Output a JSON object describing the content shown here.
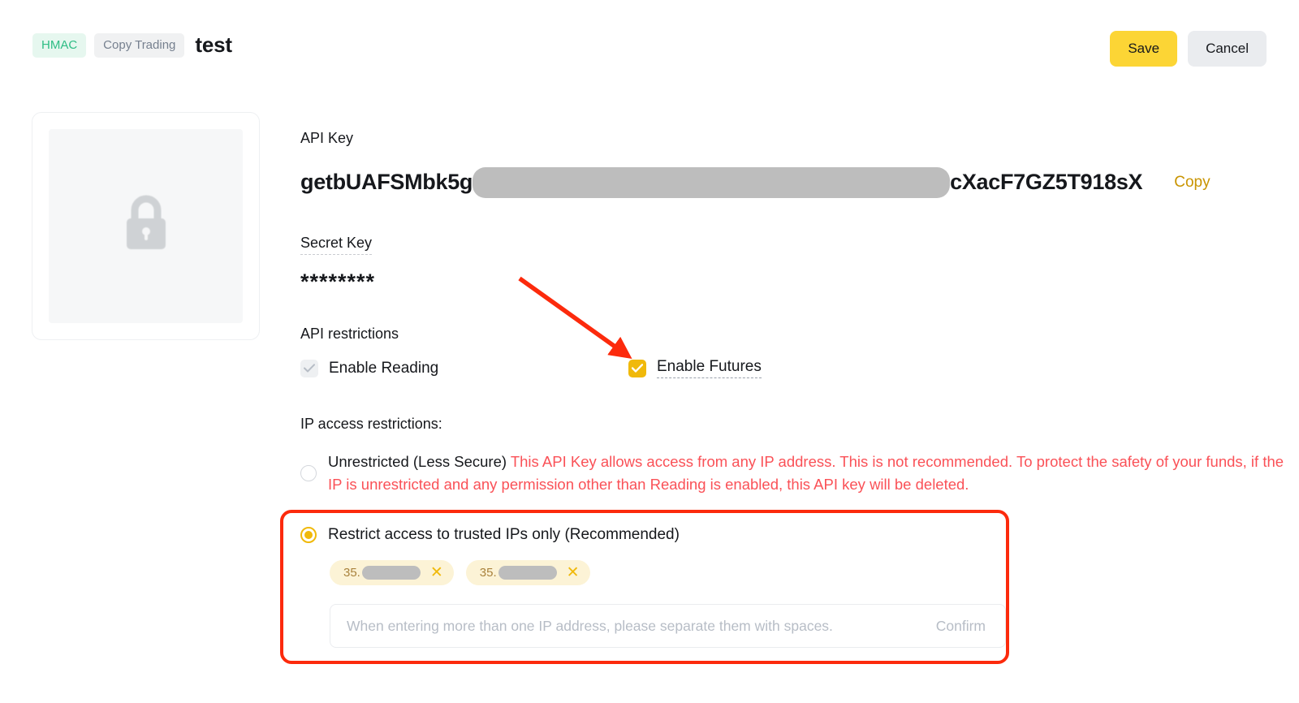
{
  "header": {
    "badges": [
      {
        "label": "HMAC",
        "style": "hmac"
      },
      {
        "label": "Copy Trading",
        "style": "copy-trading"
      }
    ],
    "key_name": "test",
    "save_label": "Save",
    "cancel_label": "Cancel"
  },
  "qr": {
    "icon": "lock-icon"
  },
  "api_key": {
    "label": "API Key",
    "value_prefix": "getbUAFSMbk5g",
    "value_suffix": "cXacF7GZ5T918sX",
    "redacted": true,
    "copy_label": "Copy"
  },
  "secret_key": {
    "label": "Secret Key",
    "value": "********"
  },
  "restrictions": {
    "label": "API restrictions",
    "items": [
      {
        "label": "Enable Reading",
        "checked": true,
        "disabled": true
      },
      {
        "label": "Enable Futures",
        "checked": true,
        "disabled": false
      }
    ]
  },
  "ip_access": {
    "title": "IP access restrictions:",
    "unrestricted": {
      "title": "Unrestricted (Less Secure)",
      "warning_inline": "This API Key allows access from any IP address. This is not recommended.",
      "warning_block": "To protect the safety of your funds, if the IP is unrestricted and any permission other than Reading is enabled, this API key will be deleted.",
      "selected": false
    },
    "trusted": {
      "label": "Restrict access to trusted IPs only (Recommended)",
      "selected": true,
      "ip_tags": [
        {
          "prefix": "35.",
          "redacted": true,
          "remove_icon": "close-icon"
        },
        {
          "prefix": "35.",
          "redacted": true,
          "remove_icon": "close-icon"
        }
      ],
      "input_placeholder": "When entering more than one IP address, please separate them with spaces.",
      "input_value": "",
      "confirm_label": "Confirm"
    }
  },
  "annotations": {
    "arrow_color": "#fc2a0c",
    "highlight_color": "#fc2a0c"
  },
  "colors": {
    "accent_yellow": "#f0b90b",
    "save_yellow": "#fcd535",
    "warning_red": "#fa5157",
    "hmac_green": "#2ebd85",
    "copy_gold": "#c99400"
  }
}
